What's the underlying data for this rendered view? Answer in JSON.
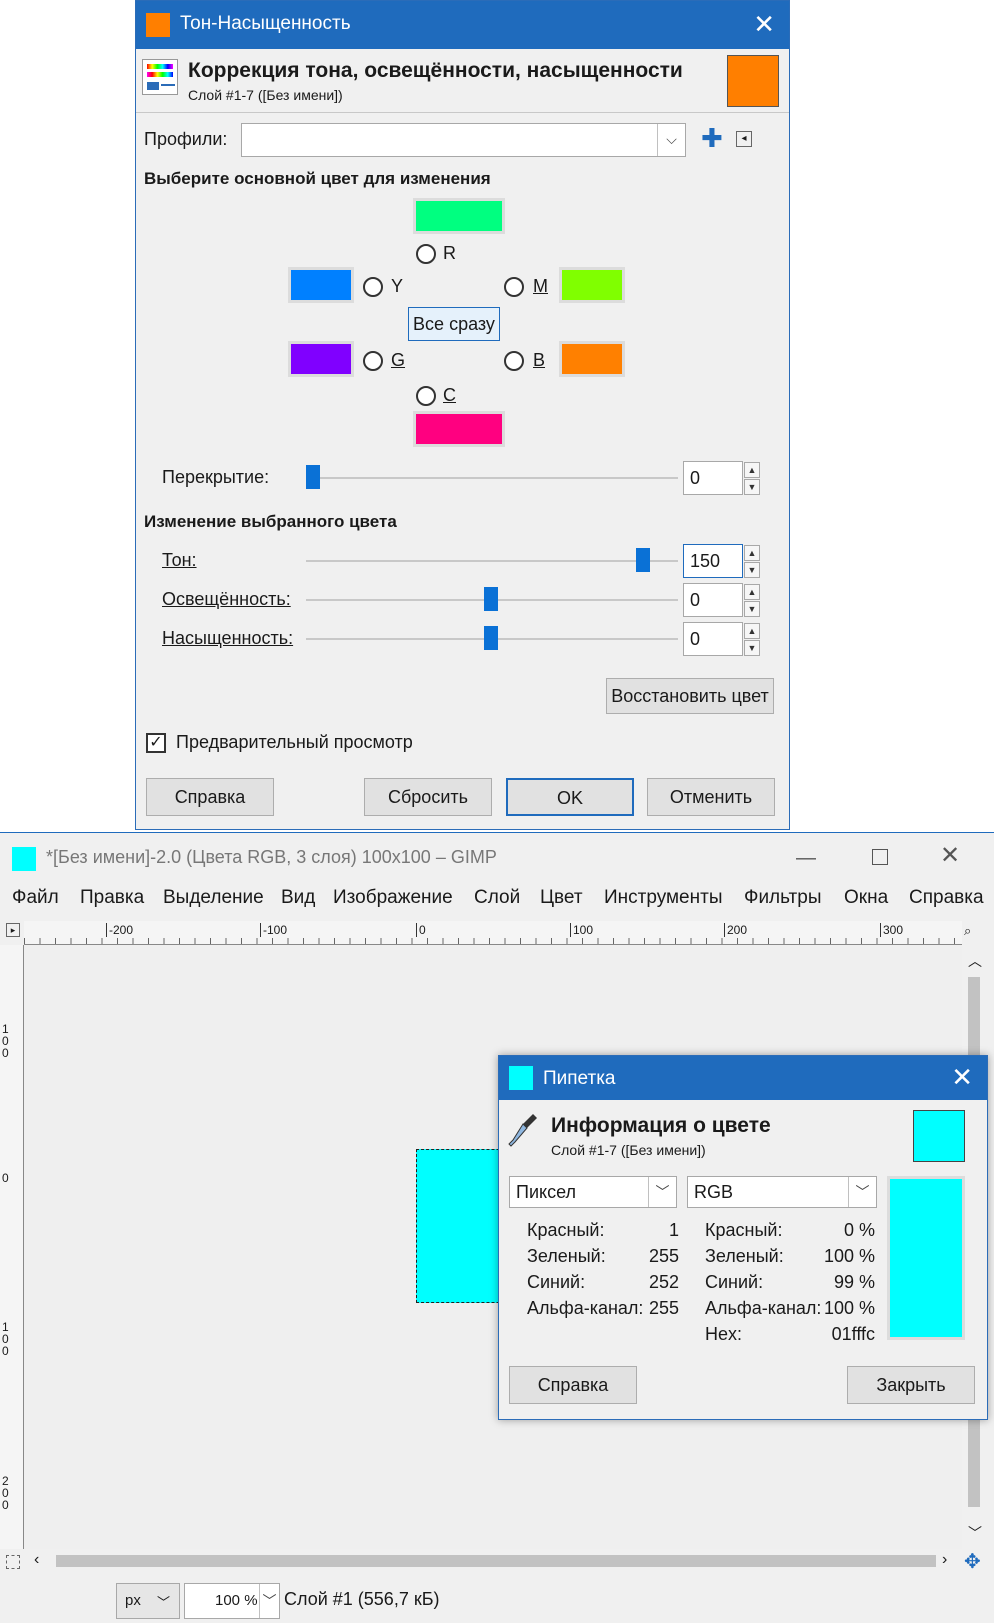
{
  "hue_saturation": {
    "window_title": "Тон-Насыщенность",
    "header_title": "Коррекция тона, освещённости, насыщенности",
    "header_subtitle": "Слой #1-7 ([Без имени])",
    "presets_label": "Профили:",
    "presets_value": "",
    "primary_color_label": "Выберите основной цвет для изменения",
    "radio_r": "R",
    "radio_y": "Y",
    "radio_m": "M",
    "radio_g": "G",
    "radio_b": "B",
    "radio_c": "C",
    "master_button": "Все сразу",
    "overlap_label": "Перекрытие:",
    "overlap_value": "0",
    "adjust_label": "Изменение выбранного цвета",
    "hue_label": "Тон:",
    "hue_value": "150",
    "lightness_label": "Освещённость:",
    "lightness_value": "0",
    "saturation_label": "Насыщенность:",
    "saturation_value": "0",
    "reset_color_button": "Восстановить цвет",
    "preview_label": "Предварительный просмотр",
    "preview_checked": true,
    "help_button": "Справка",
    "reset_button": "Сбросить",
    "ok_button": "OK",
    "cancel_button": "Отменить",
    "colors": {
      "title_swatch": "#ff7f00",
      "swatch_r": "#00ff80",
      "swatch_y": "#0080ff",
      "swatch_m": "#80ff00",
      "swatch_g": "#8000ff",
      "swatch_b": "#ff8000",
      "swatch_c": "#ff0080",
      "accent": "#1f6bbd"
    },
    "slider_levels": {
      "overlap": 0.0,
      "hue": 0.89,
      "lightness": 0.5,
      "saturation": 0.5
    }
  },
  "gimp": {
    "window_title": "*[Без имени]-2.0 (Цвета RGB, 3 слоя) 100x100 – GIMP",
    "menu": [
      "Файл",
      "Правка",
      "Выделение",
      "Вид",
      "Изображение",
      "Слой",
      "Цвет",
      "Инструменты",
      "Фильтры",
      "Окна",
      "Справка"
    ],
    "ruler_labels_h": [
      "-200",
      "-100",
      "0",
      "100",
      "200",
      "300"
    ],
    "ruler_labels_v": [
      "100",
      "0",
      "100",
      "200"
    ],
    "status_unit": "px",
    "status_zoom": "100 %",
    "status_text": "Слой #1 (556,7 кБ)",
    "canvas_color": "#00ffff"
  },
  "color_picker": {
    "window_title": "Пипетка",
    "header_title": "Информация о цвете",
    "header_subtitle": "Слой #1-7 ([Без имени])",
    "mode_left": "Пиксел",
    "mode_right": "RGB",
    "left_rows": [
      {
        "label": "Красный:",
        "value": "1"
      },
      {
        "label": "Зеленый:",
        "value": "255"
      },
      {
        "label": "Синий:",
        "value": "252"
      },
      {
        "label": "Альфа-канал:",
        "value": "255"
      }
    ],
    "right_rows": [
      {
        "label": "Красный:",
        "value": "0 %"
      },
      {
        "label": "Зеленый:",
        "value": "100 %"
      },
      {
        "label": "Синий:",
        "value": "99 %"
      },
      {
        "label": "Альфа-канал:",
        "value": "100 %"
      },
      {
        "label": "Hex:",
        "value": "01fffc"
      }
    ],
    "help_button": "Справка",
    "close_button": "Закрыть",
    "picked_color": "#00ffff"
  }
}
